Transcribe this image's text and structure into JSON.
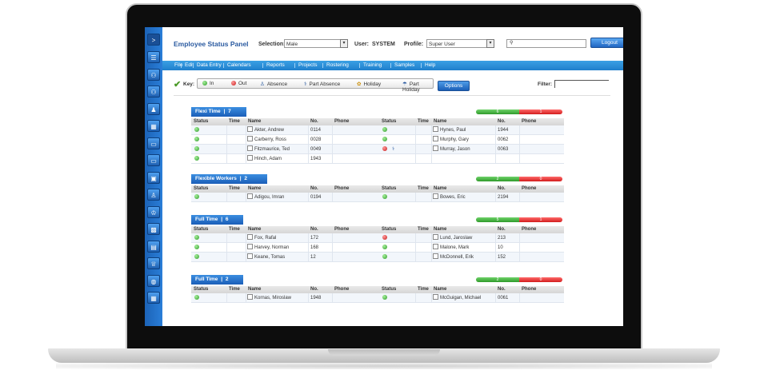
{
  "app": {
    "title": "Employee Status Panel"
  },
  "header": {
    "selection_label": "Selection:",
    "selection_value": "Male",
    "user_label": "User:",
    "user_value": "SYSTEM",
    "profile_label": "Profile:",
    "profile_value": "Super User",
    "search_icon": "search-icon",
    "logout_label": "Logout"
  },
  "menu": [
    "File",
    "Edit",
    "Data Entry",
    "Calendars",
    "Reports",
    "Projects",
    "Rostering",
    "Training",
    "Samples",
    "Help"
  ],
  "key": {
    "label": "Key:",
    "items": [
      "In",
      "Out",
      "Absence",
      "Part Absence",
      "Holiday",
      "Part Holiday"
    ],
    "options_label": "Options",
    "filter_label": "Filter:"
  },
  "columns": {
    "status": "Status",
    "time": "Time",
    "name": "Name",
    "no": "No.",
    "phone": "Phone"
  },
  "groups": [
    {
      "title": "Flexi Time",
      "count": "7",
      "in_count": "6",
      "out_count": "1",
      "left": [
        {
          "status": "in",
          "name": "Akter, Andrew",
          "no": "0114"
        },
        {
          "status": "in",
          "name": "Carberry, Ross",
          "no": "0028"
        },
        {
          "status": "in",
          "name": "Fitzmaurice, Ted",
          "no": "0049"
        },
        {
          "status": "in",
          "name": "Hinch, Adam",
          "no": "1943"
        }
      ],
      "right": [
        {
          "status": "in",
          "name": "Hynes, Paul",
          "no": "1944"
        },
        {
          "status": "in",
          "name": "Murphy, Gary",
          "no": "0062"
        },
        {
          "status": "out",
          "name": "Murray, Jason",
          "no": "0063",
          "extra_icon": "part-absence-icon"
        }
      ]
    },
    {
      "title": "Flexible Workers",
      "count": "2",
      "in_count": "2",
      "out_count": "0",
      "left": [
        {
          "status": "in",
          "name": "Adigou, Imran",
          "no": "0194"
        }
      ],
      "right": [
        {
          "status": "in",
          "name": "Bowes, Eric",
          "no": "2194"
        }
      ]
    },
    {
      "title": "Full Time",
      "count": "6",
      "in_count": "5",
      "out_count": "1",
      "left": [
        {
          "status": "in",
          "name": "Fox, Rafal",
          "no": "172"
        },
        {
          "status": "in",
          "name": "Harvey, Norman",
          "no": "168"
        },
        {
          "status": "in",
          "name": "Keane, Tomas",
          "no": "12"
        }
      ],
      "right": [
        {
          "status": "out",
          "name": "Lund, Jaroslaw",
          "no": "213"
        },
        {
          "status": "in",
          "name": "Malone, Mark",
          "no": "10"
        },
        {
          "status": "in",
          "name": "McDonnell, Erik",
          "no": "152"
        }
      ]
    },
    {
      "title": "Full Time",
      "count": "2",
      "in_count": "2",
      "out_count": "0",
      "left": [
        {
          "status": "in",
          "name": "Kornas, Miroslaw",
          "no": "1948"
        }
      ],
      "right": [
        {
          "status": "in",
          "name": "McGuigan, Michael",
          "no": "0061"
        }
      ]
    }
  ],
  "sidebar_icons": [
    "expand-icon",
    "list-icon",
    "people-icon",
    "users-icon",
    "person-icon",
    "calendar-icon",
    "card-icon",
    "window-icon",
    "monitor-icon",
    "group-icon",
    "team-icon",
    "badge-icon",
    "id-card-icon",
    "award-icon",
    "globe-icon",
    "grid-icon"
  ],
  "colors": {
    "accent": "#2a7ed8",
    "in": "#2f9a2a",
    "out": "#d21c1c"
  }
}
